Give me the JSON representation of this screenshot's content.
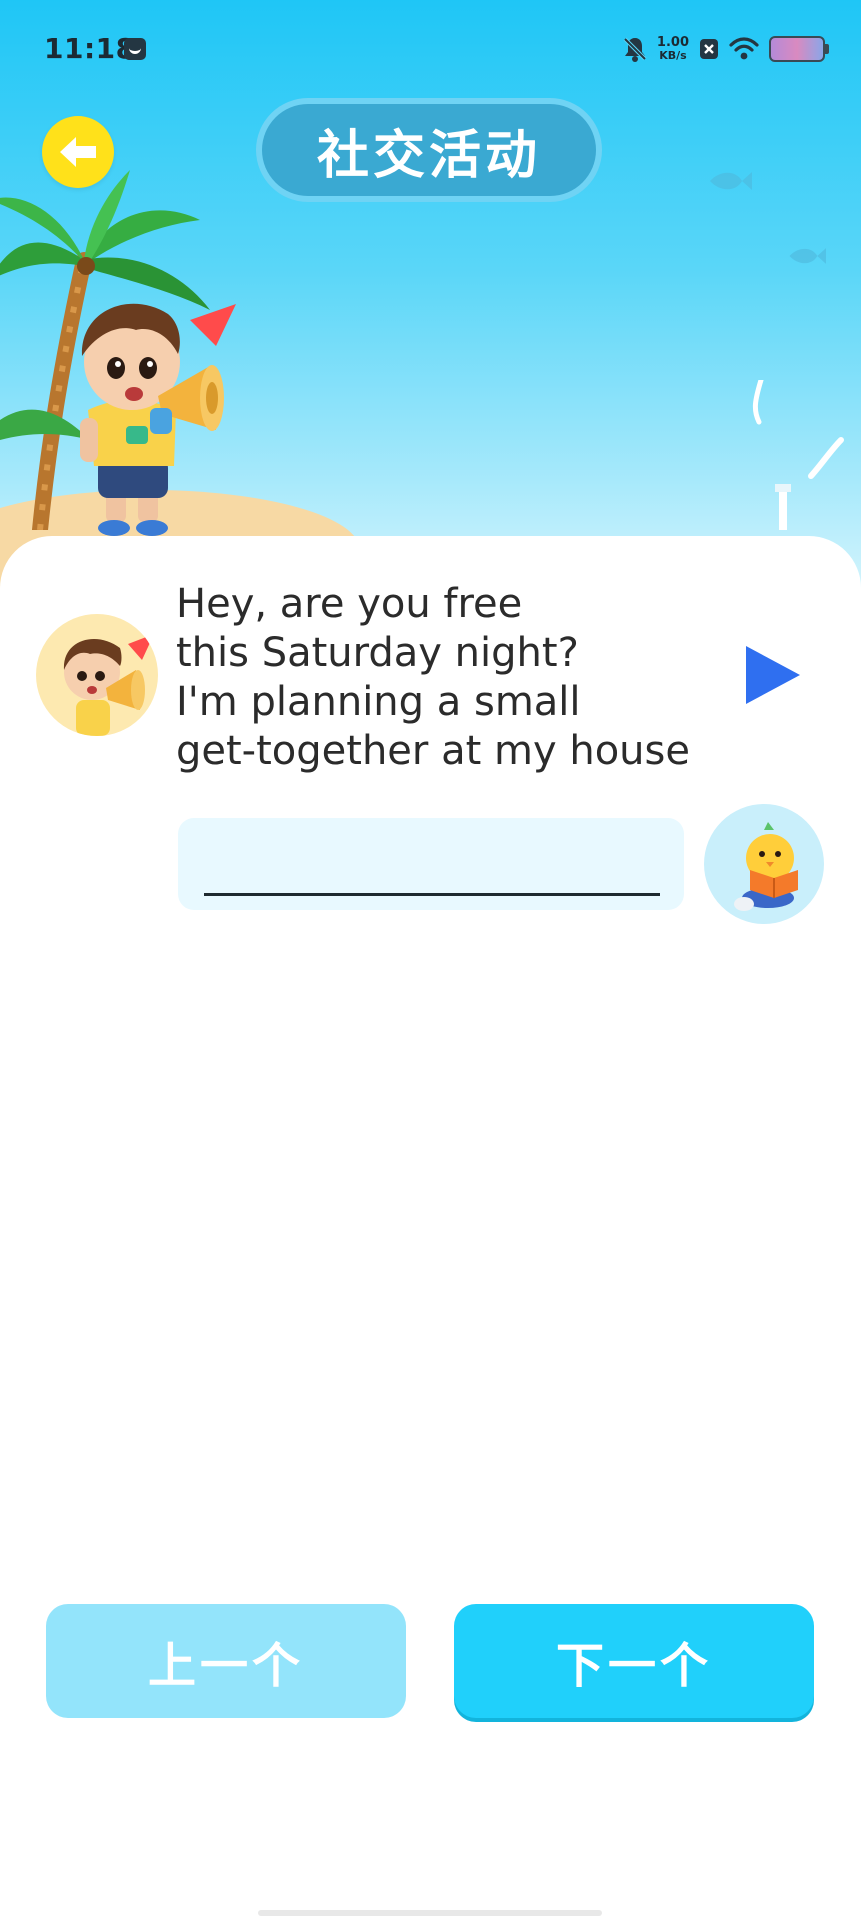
{
  "status_bar": {
    "time": "11:18",
    "network_speed_value": "1.00",
    "network_speed_unit": "KB/s",
    "icons": [
      "app-notification-icon",
      "mute-bell-icon",
      "x-box-icon",
      "wifi-icon",
      "battery-icon"
    ]
  },
  "header": {
    "title": "社交活动",
    "back_icon": "arrow-left-icon"
  },
  "dialogue": {
    "lines": [
      "Hey, are you free",
      "this Saturday night?",
      "I'm planning a small",
      "get-together at my house"
    ],
    "play_icon": "play-triangle-icon",
    "avatar_icon": "boy-megaphone-avatar"
  },
  "answer": {
    "value": "",
    "helper_icon": "reading-chick-icon"
  },
  "navigation": {
    "prev_label": "上一个",
    "next_label": "下一个"
  },
  "colors": {
    "sky": "#1fc6f6",
    "title_pill": "#3aa9d2",
    "back_button": "#ffe11a",
    "play": "#2f6ff0",
    "prev_button": "#93e4fb",
    "next_button": "#20d0fb",
    "answer_box": "#e8f9ff"
  }
}
